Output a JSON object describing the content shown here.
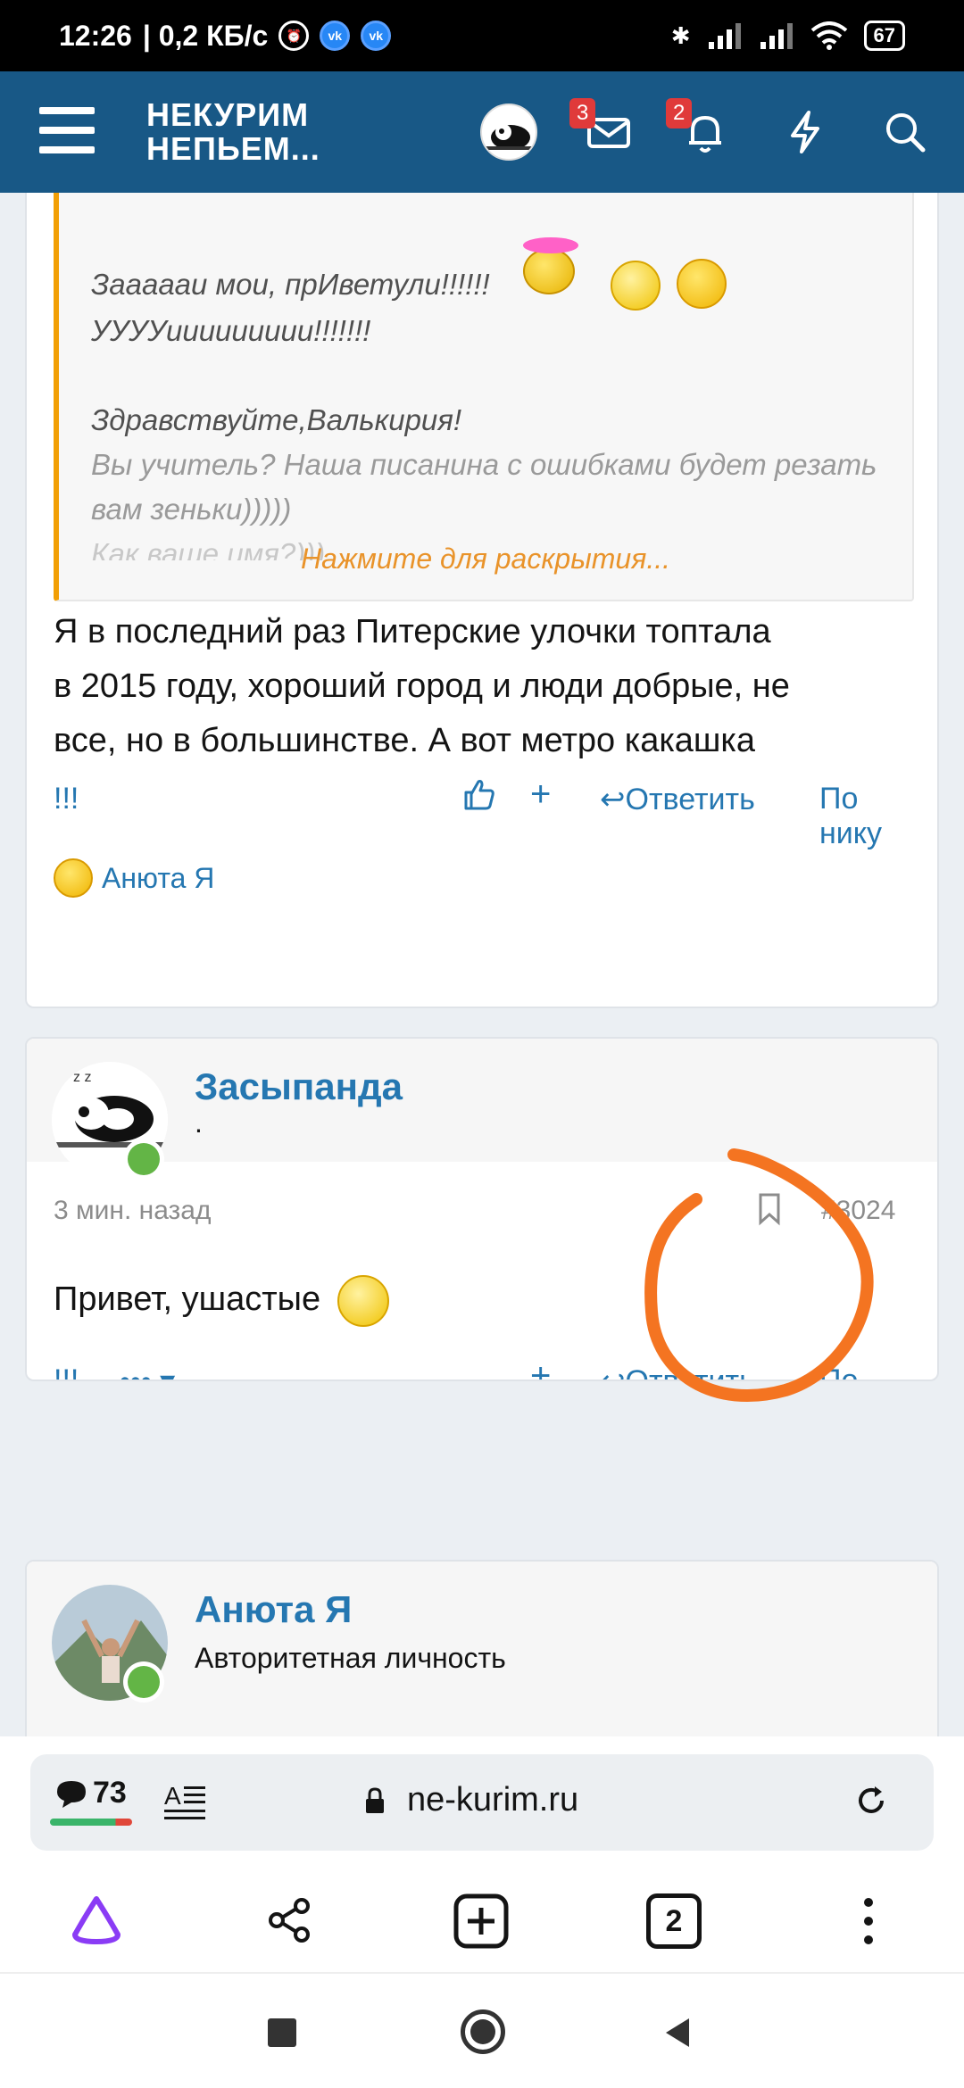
{
  "status_bar": {
    "time": "12:26",
    "speed": "| 0,2 КБ/с",
    "battery": "67"
  },
  "header": {
    "brand_line1": "НЕКУРИМ",
    "brand_line2": "НЕПЬЕМ...",
    "messages_count": "3",
    "alerts_count": "2"
  },
  "post1": {
    "quote_lines": [
      "Зааааaи мои, прИветули!!!!!!",
      "УУУУиииииииии!!!!!!!",
      "Здравствуйте,Валькирия!",
      "Вы учитель? Наша писанина с ошибками будет резать",
      "вам зеньки)))))",
      "Как ваше имя?)))"
    ],
    "expand_label": "Нажмите для раскрытия...",
    "text_lines": [
      "Я в последний раз Питерские улочки топтала",
      "в 2015 году, хороший город и люди добрые, не",
      "все, но в большинстве. А вот метро какашка"
    ],
    "actions": {
      "report": "!!!",
      "plus": "+",
      "reply": "Ответить",
      "by_nick": "По нику"
    },
    "reaction_user": "Анюта Я"
  },
  "post2": {
    "username": "Засыпанда",
    "user_title": ".",
    "time": "3 мин. назад",
    "post_number": "#3024",
    "text": "Привет, ушастые",
    "actions": {
      "report": "!!!",
      "more": "•••",
      "plus": "+",
      "reply": "Ответить",
      "by_nick": "По нику"
    }
  },
  "post3": {
    "username": "Анюта Я",
    "user_title": "Авторитетная личность"
  },
  "browser": {
    "comments_count": "73",
    "url": "ne-kurim.ru",
    "tabs_count": "2"
  },
  "colors": {
    "header_bg": "#185886",
    "link_blue": "#2577b1",
    "quote_accent": "#f29f05",
    "annotation_orange": "#f47421"
  }
}
